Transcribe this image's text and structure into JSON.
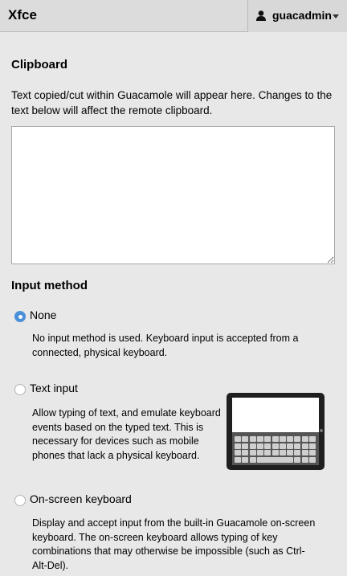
{
  "header": {
    "title": "Xfce",
    "username": "guacadmin"
  },
  "clipboard": {
    "title": "Clipboard",
    "description": "Text copied/cut within Guacamole will appear here. Changes to the text below will affect the remote clipboard.",
    "value": ""
  },
  "input_method": {
    "title": "Input method",
    "options": [
      {
        "label": "None",
        "selected": true,
        "description": "No input method is used. Keyboard input is accepted from a connected, physical keyboard."
      },
      {
        "label": "Text input",
        "selected": false,
        "description": "Allow typing of text, and emulate keyboard events based on the typed text. This is necessary for devices such as mobile phones that lack a physical keyboard."
      },
      {
        "label": "On-screen keyboard",
        "selected": false,
        "description": "Display and accept input from the built-in Guacamole on-screen keyboard. The on-screen keyboard allows typing of key combinations that may otherwise be impossible (such as Ctrl-Alt-Del)."
      }
    ]
  },
  "colors": {
    "accent": "#4a90d9",
    "header_bg": "#dcdcdc",
    "page_bg": "#e8e8e8"
  },
  "icons": [
    "user-icon",
    "chevron-down-icon",
    "tablet-keyboard-illustration"
  ]
}
